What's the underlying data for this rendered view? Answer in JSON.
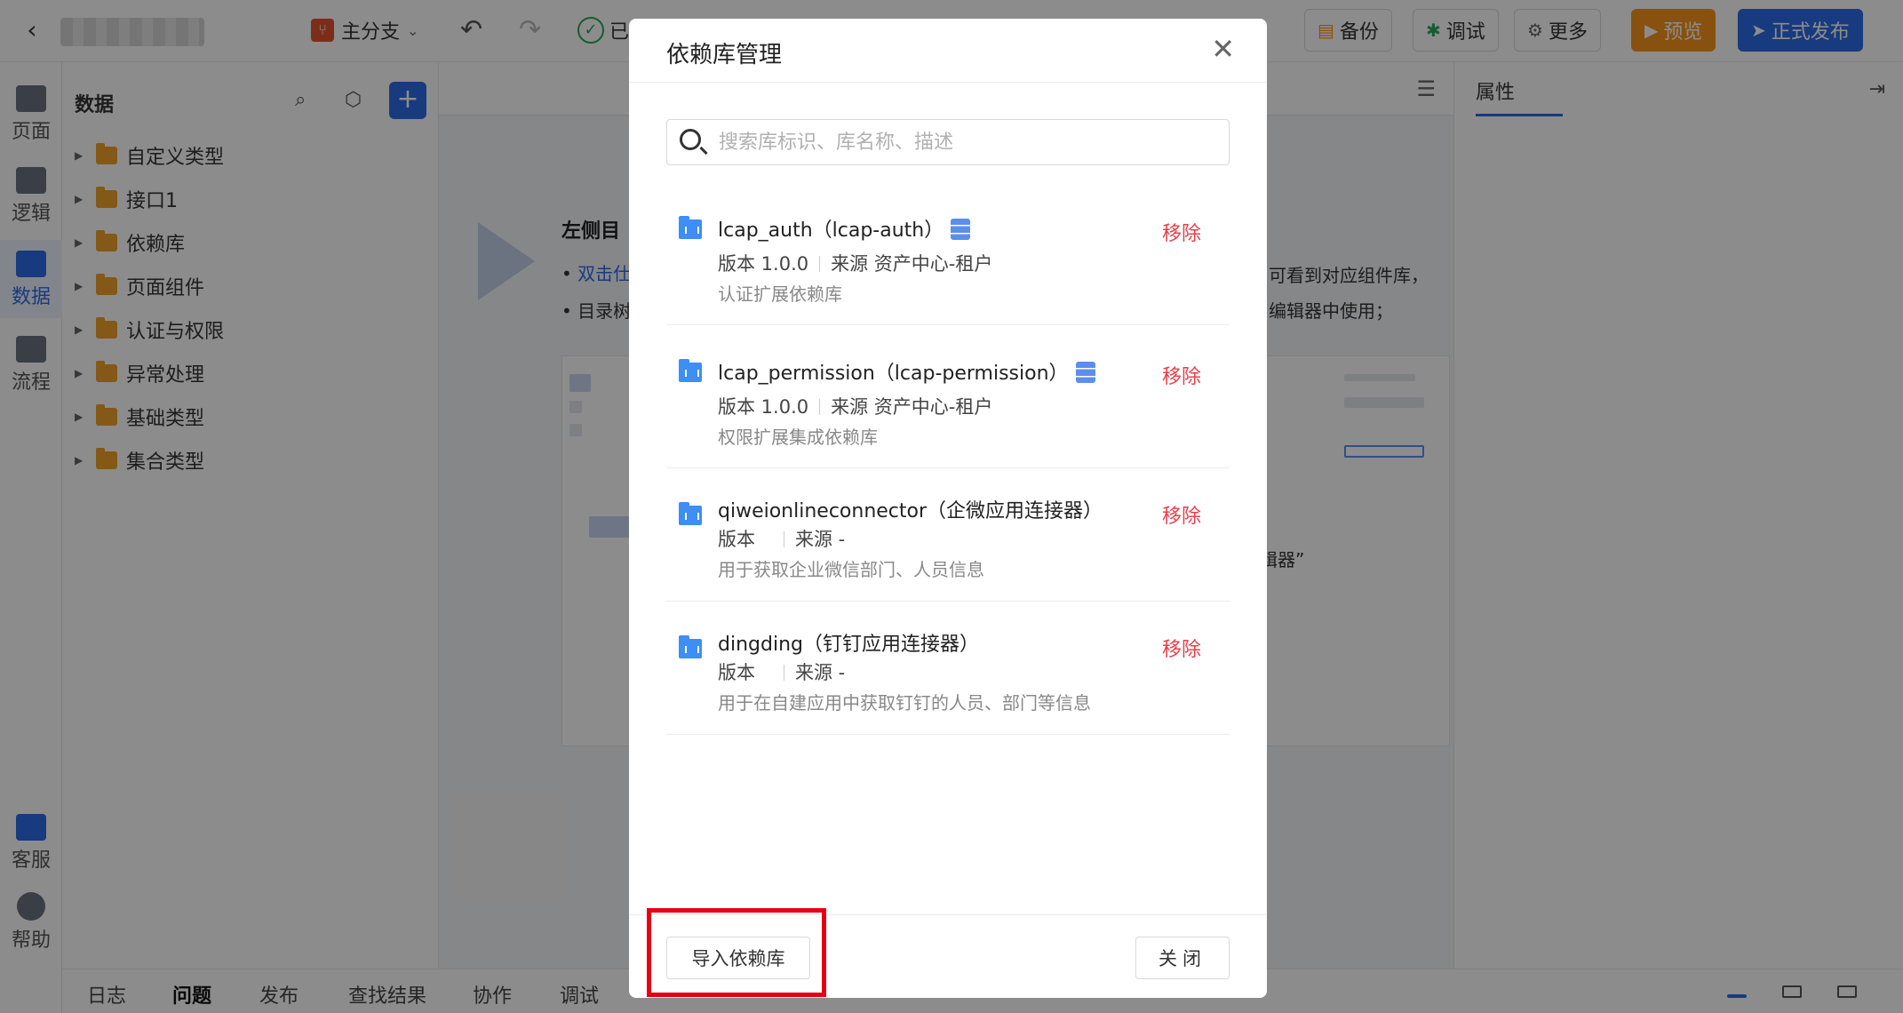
{
  "topbar": {
    "branch_label": "主分支",
    "saved_label": "已",
    "backup_label": "备份",
    "debug_label": "调试",
    "more_label": "更多",
    "preview_label": "预览",
    "publish_label": "正式发布"
  },
  "rail": {
    "items": [
      {
        "label": "页面"
      },
      {
        "label": "逻辑"
      },
      {
        "label": "数据"
      },
      {
        "label": "流程"
      }
    ],
    "service_label": "客服",
    "help_label": "帮助"
  },
  "tree": {
    "title": "数据",
    "items": [
      {
        "label": "自定义类型"
      },
      {
        "label": "接口1"
      },
      {
        "label": "依赖库"
      },
      {
        "label": "页面组件"
      },
      {
        "label": "认证与权限"
      },
      {
        "label": "异常处理"
      },
      {
        "label": "基础类型"
      },
      {
        "label": "集合类型"
      }
    ]
  },
  "guide": {
    "title": "左侧目",
    "line1_link": "双击仕",
    "line2": "目录树",
    "right1": "可看到对应组件库，",
    "right2": "编辑器中使用；",
    "caption": "辑器”"
  },
  "props": {
    "tab_label": "属性"
  },
  "bottombar": {
    "tabs": [
      {
        "label": "日志"
      },
      {
        "label": "问题"
      },
      {
        "label": "发布"
      },
      {
        "label": "查找结果"
      },
      {
        "label": "协作"
      },
      {
        "label": "调试"
      }
    ]
  },
  "modal": {
    "title": "依赖库管理",
    "search_placeholder": "搜索库标识、库名称、描述",
    "libraries": [
      {
        "name": "lcap_auth（lcap-auth）",
        "version_label": "版本 1.0.0",
        "source_label": "来源 资产中心-租户",
        "description": "认证扩展依赖库",
        "remove_label": "移除"
      },
      {
        "name": "lcap_permission（lcap-permission）",
        "version_label": "版本 1.0.0",
        "source_label": "来源 资产中心-租户",
        "description": "权限扩展集成依赖库",
        "remove_label": "移除"
      },
      {
        "name": "qiweionlineconnector（企微应用连接器）",
        "version_label": "版本",
        "source_label": "来源 -",
        "description": "用于获取企业微信部门、人员信息",
        "remove_label": "移除"
      },
      {
        "name": "dingding（钉钉应用连接器）",
        "version_label": "版本",
        "source_label": "来源 -",
        "description": "用于在自建应用中获取钉钉的人员、部门等信息",
        "remove_label": "移除"
      }
    ],
    "import_label": "导入依赖库",
    "close_label": "关闭"
  },
  "colors": {
    "accent": "#2d6ae5",
    "preview": "#f7941d",
    "remove": "#e5414c",
    "highlight": "#e60012"
  }
}
